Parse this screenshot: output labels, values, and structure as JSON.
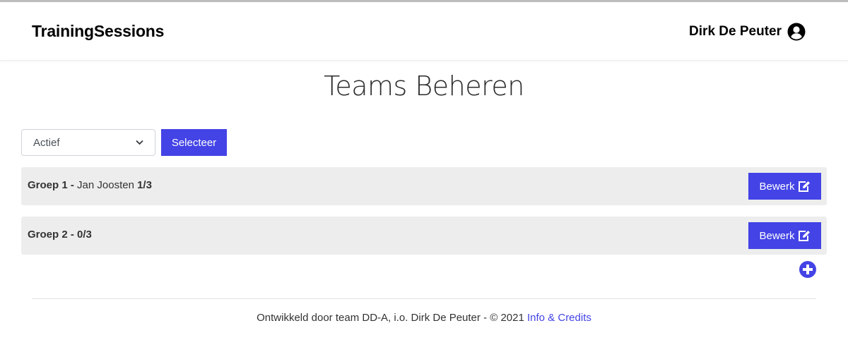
{
  "navbar": {
    "brand": "TrainingSessions",
    "user_name": "Dirk De Peuter",
    "user_icon": "user-circle-icon"
  },
  "page": {
    "title": "Teams Beheren"
  },
  "filter": {
    "selected": "Actief",
    "button_label": "Selecteer"
  },
  "teams": [
    {
      "name": "Groep 1 -",
      "coach": "Jan Joosten",
      "count": "1/3",
      "edit_label": "Bewerk"
    },
    {
      "name": "Groep 2 - 0/3",
      "coach": "",
      "count": "",
      "edit_label": "Bewerk"
    }
  ],
  "add_icon": "plus-circle-icon",
  "footer": {
    "text": "Ontwikkeld door team DD-A, i.o. Dirk De Peuter - © 2021",
    "link_label": "Info & Credits"
  },
  "colors": {
    "accent": "#4343e6",
    "row_background": "#ededed"
  }
}
